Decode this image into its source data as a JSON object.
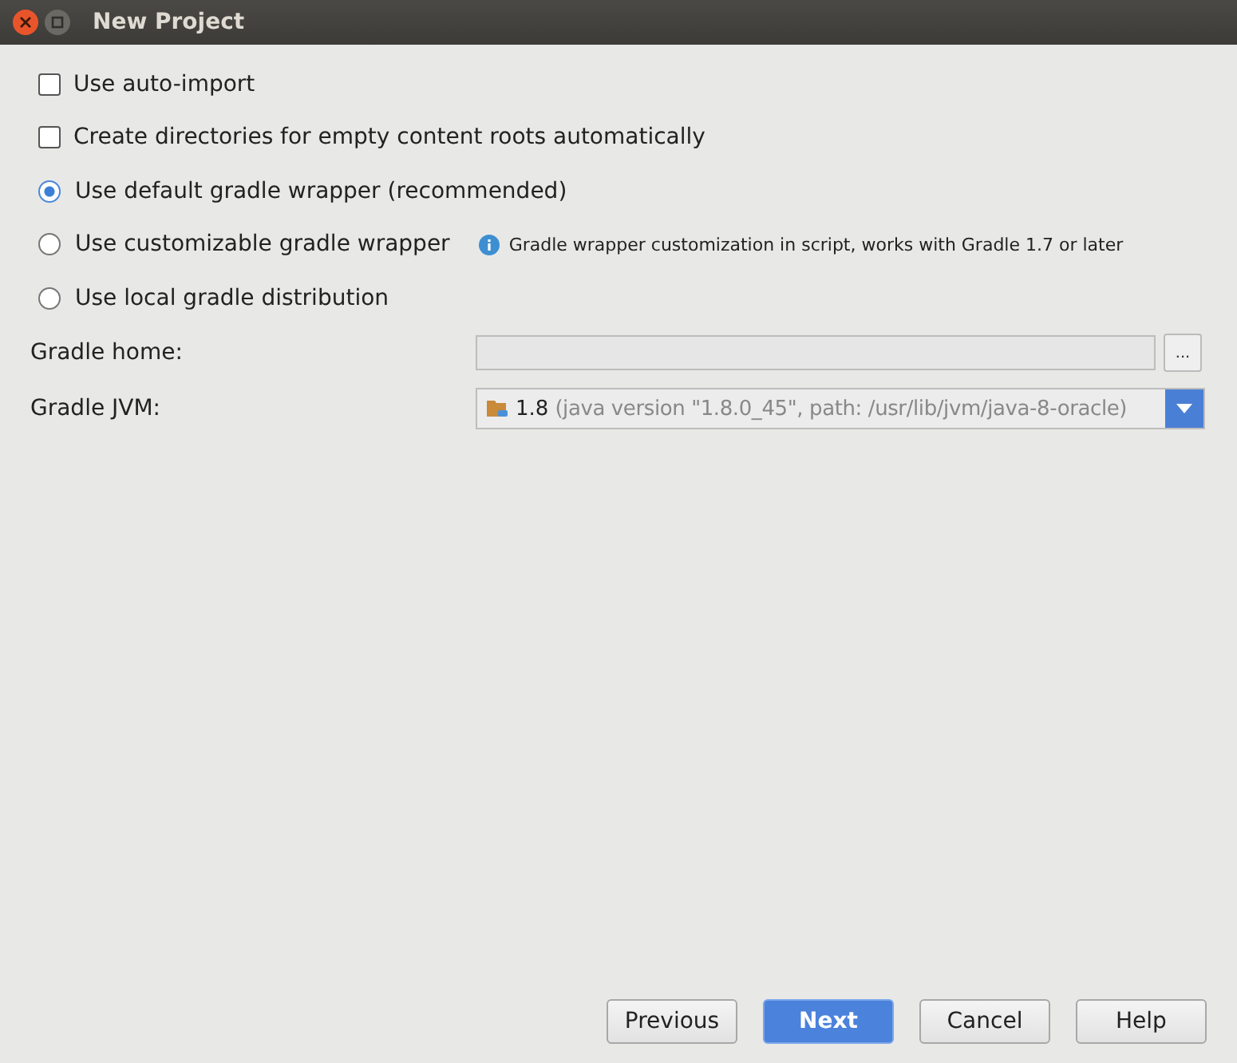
{
  "window": {
    "title": "New Project"
  },
  "options": [
    {
      "kind": "checkbox",
      "label": "Use auto-import",
      "checked": false
    },
    {
      "kind": "checkbox",
      "label": "Create directories for empty content roots automatically",
      "checked": false
    },
    {
      "kind": "radio",
      "label": "Use default gradle wrapper (recommended)",
      "selected": true
    },
    {
      "kind": "radio",
      "label": "Use customizable gradle wrapper",
      "selected": false,
      "hint": "Gradle wrapper customization in script, works with Gradle 1.7 or later"
    },
    {
      "kind": "radio",
      "label": "Use local gradle distribution",
      "selected": false
    }
  ],
  "gradle_home": {
    "label": "Gradle home:",
    "browse": "...",
    "disabled": true
  },
  "gradle_jvm": {
    "label": "Gradle JVM:",
    "version": "1.8",
    "detail": "(java version \"1.8.0_45\", path: /usr/lib/jvm/java-8-oracle)"
  },
  "buttons": [
    {
      "label": "Previous",
      "primary": false
    },
    {
      "label": "Next",
      "primary": true
    },
    {
      "label": "Cancel",
      "primary": false
    },
    {
      "label": "Help",
      "primary": false
    }
  ]
}
